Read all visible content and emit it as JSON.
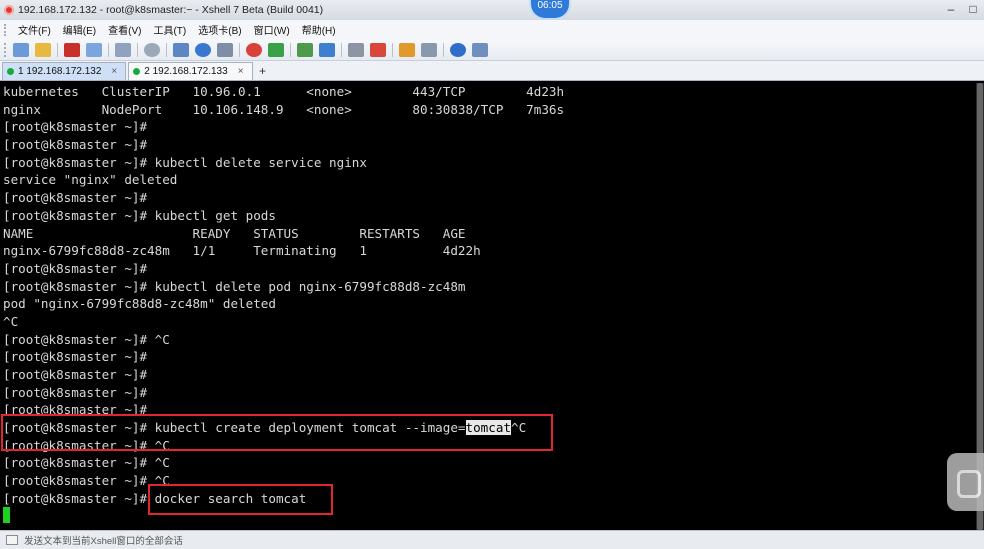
{
  "window": {
    "title": "192.168.172.132 - root@k8smaster:~ - Xshell 7 Beta (Build 0041)",
    "clock": "06:05"
  },
  "menu": [
    "文件(F)",
    "编辑(E)",
    "查看(V)",
    "工具(T)",
    "选项卡(B)",
    "窗口(W)",
    "帮助(H)"
  ],
  "tabs": [
    {
      "label": "1 192.168.172.132",
      "active": true
    },
    {
      "label": "2 192.168.172.133",
      "active": false
    }
  ],
  "tab_add_label": "+",
  "tab_close_label": "×",
  "terminal": {
    "lines": [
      "kubernetes   ClusterIP   10.96.0.1      <none>        443/TCP        4d23h",
      "nginx        NodePort    10.106.148.9   <none>        80:30838/TCP   7m36s",
      "[root@k8smaster ~]#",
      "[root@k8smaster ~]#",
      "[root@k8smaster ~]# kubectl delete service nginx",
      "service \"nginx\" deleted",
      "[root@k8smaster ~]#",
      "[root@k8smaster ~]# kubectl get pods",
      "NAME                     READY   STATUS        RESTARTS   AGE",
      "nginx-6799fc88d8-zc48m   1/1     Terminating   1          4d22h",
      "[root@k8smaster ~]#",
      "[root@k8smaster ~]# kubectl delete pod nginx-6799fc88d8-zc48m",
      "pod \"nginx-6799fc88d8-zc48m\" deleted",
      "^C",
      "[root@k8smaster ~]# ^C",
      "[root@k8smaster ~]#",
      "[root@k8smaster ~]#",
      "[root@k8smaster ~]#",
      "[root@k8smaster ~]#",
      "",
      "[root@k8smaster ~]# ^C",
      "[root@k8smaster ~]# ^C",
      "[root@k8smaster ~]# ^C",
      "[root@k8smaster ~]# docker search tomcat"
    ],
    "create_cmd_prefix": "[root@k8smaster ~]# kubectl create deployment tomcat --image=",
    "create_cmd_highlight": "tomcat",
    "create_cmd_suffix": "^C"
  },
  "statusbar": {
    "text": "发送文本到当前Xshell窗口的全部会话"
  },
  "colors": {
    "terminal_bg": "#000000",
    "terminal_fg": "#d8d8d8",
    "cursor": "#1fd11f",
    "annotation_box": "#e0262e",
    "tab_dot": "#19a83c"
  }
}
